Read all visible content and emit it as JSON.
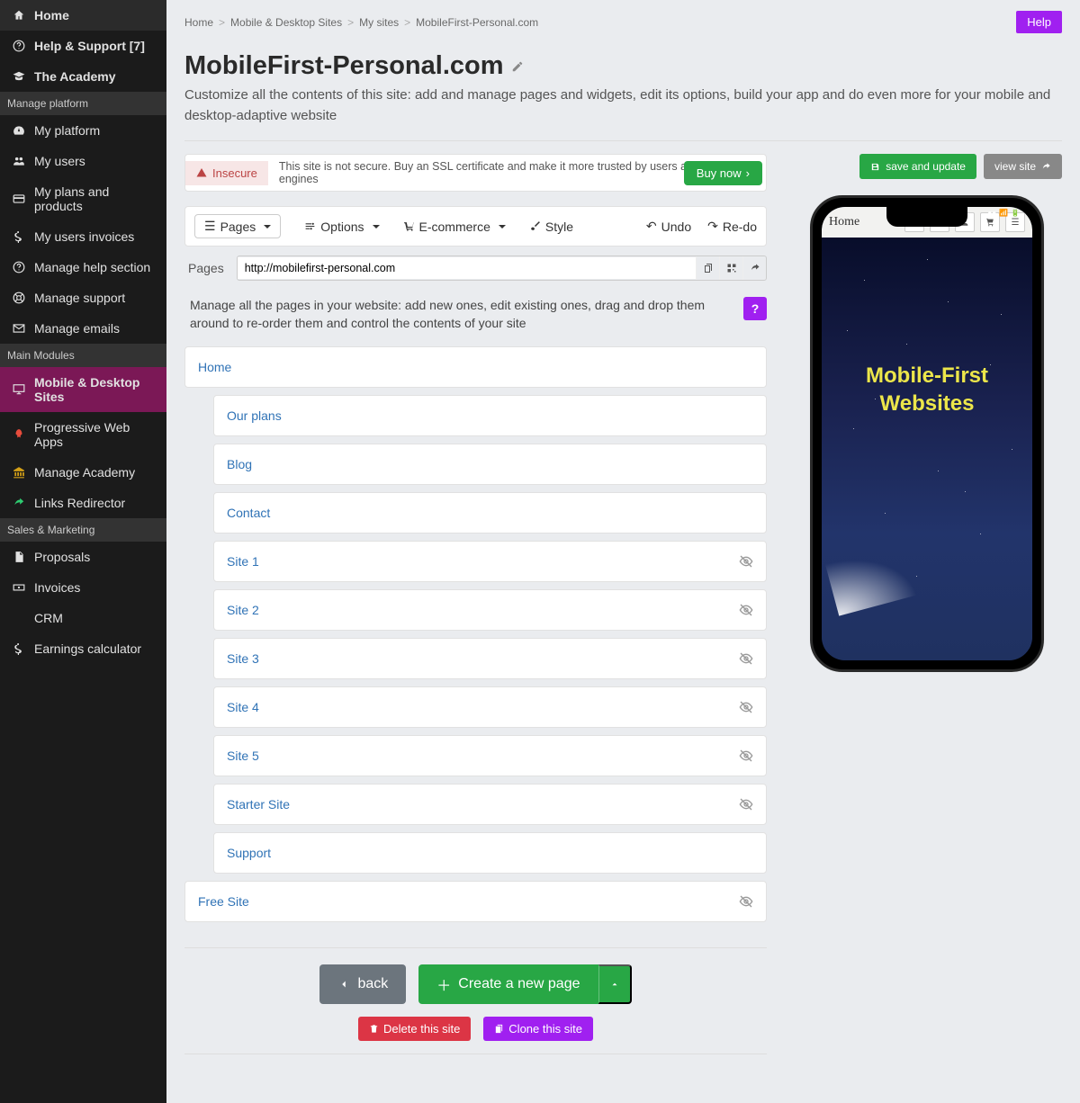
{
  "sidebar": {
    "items": [
      {
        "label": "Home",
        "icon": "home"
      },
      {
        "label": "Help & Support [7]",
        "icon": "question"
      },
      {
        "label": "The Academy",
        "icon": "graduation"
      }
    ],
    "section_platform": "Manage platform",
    "platform_items": [
      {
        "label": "My platform",
        "icon": "tachometer"
      },
      {
        "label": "My users",
        "icon": "users"
      },
      {
        "label": "My plans and products",
        "icon": "creditcard"
      },
      {
        "label": "My users invoices",
        "icon": "dollar"
      },
      {
        "label": "Manage help section",
        "icon": "question"
      },
      {
        "label": "Manage support",
        "icon": "lifebuoy"
      },
      {
        "label": "Manage emails",
        "icon": "envelope"
      }
    ],
    "section_modules": "Main Modules",
    "modules_items": [
      {
        "label": "Mobile & Desktop Sites",
        "icon": "desktop",
        "active": true
      },
      {
        "label": "Progressive Web Apps",
        "icon": "rocket"
      },
      {
        "label": "Manage Academy",
        "icon": "bank"
      },
      {
        "label": "Links Redirector",
        "icon": "share"
      }
    ],
    "section_sales": "Sales & Marketing",
    "sales_items": [
      {
        "label": "Proposals",
        "icon": "file"
      },
      {
        "label": "Invoices",
        "icon": "money"
      },
      {
        "label": "CRM",
        "icon": ""
      },
      {
        "label": "Earnings calculator",
        "icon": "dollar"
      }
    ]
  },
  "breadcrumb": [
    "Home",
    "Mobile & Desktop Sites",
    "My sites",
    "MobileFirst-Personal.com"
  ],
  "help_label": "Help",
  "page_title": "MobileFirst-Personal.com",
  "subtitle": "Customize all the contents of this site: add and manage pages and widgets, edit its options, build your app and do even more for your mobile and desktop-adaptive website",
  "alert": {
    "badge": "Insecure",
    "message": "This site is not secure. Buy an SSL certificate and make it more trusted by users and search engines",
    "buy": "Buy now"
  },
  "toolbar": {
    "pages": "Pages",
    "options": "Options",
    "ecommerce": "E-commerce",
    "style": "Style",
    "undo": "Undo",
    "redo": "Re-do"
  },
  "url_label": "Pages",
  "url_value": "http://mobilefirst-personal.com",
  "instructions": "Manage all the pages in your website: add new ones, edit existing ones, drag and drop them around to re-order them and control the contents of your site",
  "question": "?",
  "pages": [
    {
      "label": "Home",
      "indent": 0,
      "hidden": false
    },
    {
      "label": "Our plans",
      "indent": 1,
      "hidden": false
    },
    {
      "label": "Blog",
      "indent": 1,
      "hidden": false
    },
    {
      "label": "Contact",
      "indent": 1,
      "hidden": false
    },
    {
      "label": "Site 1",
      "indent": 1,
      "hidden": true
    },
    {
      "label": "Site 2",
      "indent": 1,
      "hidden": true
    },
    {
      "label": "Site 3",
      "indent": 1,
      "hidden": true
    },
    {
      "label": "Site 4",
      "indent": 1,
      "hidden": true
    },
    {
      "label": "Site 5",
      "indent": 1,
      "hidden": true
    },
    {
      "label": "Starter Site",
      "indent": 1,
      "hidden": true
    },
    {
      "label": "Support",
      "indent": 1,
      "hidden": false
    },
    {
      "label": "Free Site",
      "indent": 0,
      "hidden": true
    }
  ],
  "actions": {
    "back": "back",
    "create": "Create a new page",
    "delete": "Delete this site",
    "clone": "Clone this site"
  },
  "preview": {
    "save": "save and update",
    "view": "view site",
    "home": "Home",
    "hero": "Mobile-First Websites"
  }
}
